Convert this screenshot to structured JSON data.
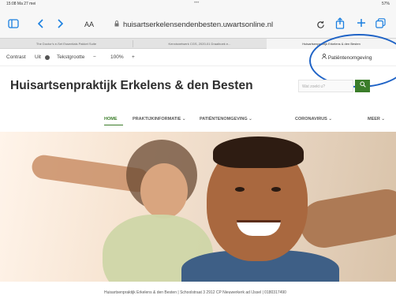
{
  "status_bar": {
    "time": "15:08  Ma 27 mei",
    "dots": "•••",
    "battery": "57%"
  },
  "browser": {
    "aa_label": "AA",
    "url": "huisartserkelensendenbesten.uwartsonline.nl",
    "icons": [
      "sidebar-icon",
      "back-icon",
      "forward-icon",
      "reload-icon",
      "share-icon",
      "new-tab-icon",
      "tabs-icon"
    ]
  },
  "tabs": [
    {
      "label": "The Doctor's e-Set Essentials Pakket Suite",
      "active": false
    },
    {
      "label": "Kennisnetwerk CGS, 2020-01 Draaiboek e...",
      "active": false
    },
    {
      "label": "Huisartsenpraktijk Erkelens & den Besten",
      "active": true
    }
  ],
  "accessibility": {
    "contrast_label": "Contrast",
    "contrast_value": "Uit",
    "text_size_label": "Tekstgrootte",
    "minus": "−",
    "zoom": "100%",
    "plus": "+",
    "patient_env_label": "Patiëntenomgeving"
  },
  "site": {
    "title": "Huisartsenpraktijk Erkelens & den Besten",
    "search_placeholder": "Wat zoekt u?"
  },
  "nav": [
    {
      "label": "HOME",
      "active": true
    },
    {
      "label": "PRAKTIJKINFORMATIE",
      "chevron": "⌄"
    },
    {
      "label": "PATIËNTENOMGEVING",
      "chevron": "⌄"
    },
    {
      "label": "CORONAVIRUS",
      "chevron": "⌄"
    },
    {
      "label": "MEER",
      "chevron": "⌄"
    }
  ],
  "footer": {
    "text": "Huisartsenpraktijk Erkelens & den Besten  |  Schoolstraat 3 2912 CP Nieuwerkerk ad IJssel  |  0180317490"
  },
  "colors": {
    "brand_green": "#3b7d2a",
    "ios_blue": "#1a7fe0",
    "annotation_circle": "#1f63c6"
  }
}
